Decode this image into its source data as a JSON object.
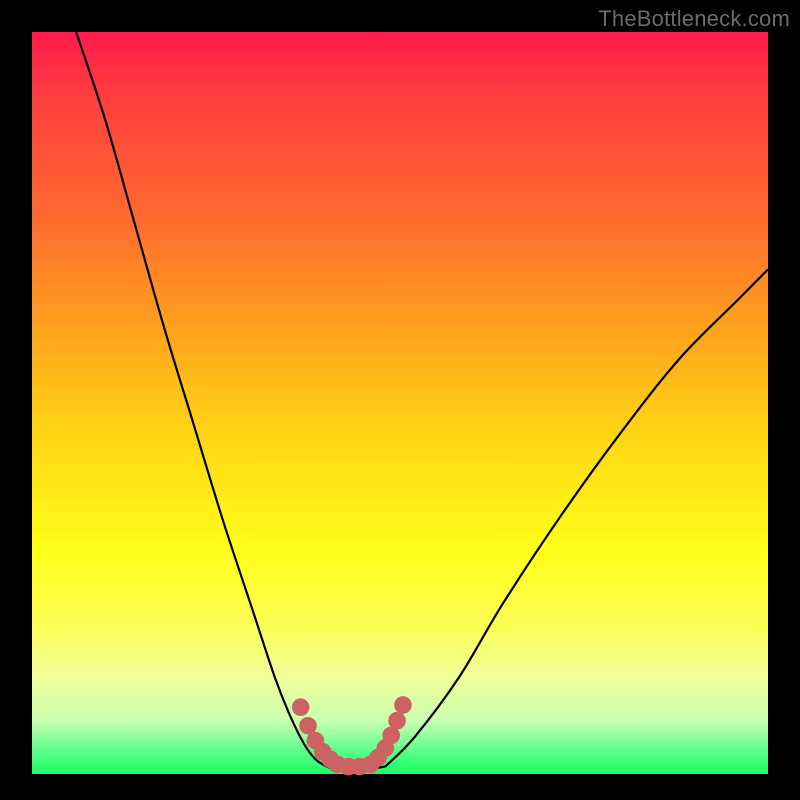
{
  "watermark": "TheBottleneck.com",
  "colors": {
    "gradient_top": "#ff1a4a",
    "gradient_mid": "#ffff1a",
    "gradient_bottom": "#1aff61",
    "curve": "#000000",
    "marker": "#cc6262",
    "frame": "#000000"
  },
  "chart_data": {
    "type": "line",
    "title": "",
    "xlabel": "",
    "ylabel": "",
    "xlim": [
      0,
      100
    ],
    "ylim": [
      0,
      100
    ],
    "grid": false,
    "legend": false,
    "description": "Two monotone curves descending from top toward a flat minimum near the bottom center, then rising; left curve steeper, right curve shallower. Pink markers cluster at/near the valley bottom on both branches.",
    "series": [
      {
        "name": "left-branch",
        "x": [
          6,
          10,
          14,
          18,
          22,
          26,
          30,
          33,
          35,
          37,
          38.5,
          40
        ],
        "y": [
          100,
          88,
          74,
          60,
          47,
          34,
          22,
          13,
          8,
          4,
          2,
          1
        ]
      },
      {
        "name": "valley-floor",
        "x": [
          40,
          42,
          44,
          46,
          48
        ],
        "y": [
          1,
          0.5,
          0.5,
          0.7,
          1
        ]
      },
      {
        "name": "right-branch",
        "x": [
          48,
          52,
          58,
          64,
          72,
          80,
          88,
          96,
          100
        ],
        "y": [
          1,
          5,
          13,
          23,
          35,
          46,
          56,
          64,
          68
        ]
      }
    ],
    "markers": {
      "name": "valley-markers",
      "points": [
        {
          "x": 36.5,
          "y": 9
        },
        {
          "x": 37.5,
          "y": 6.5
        },
        {
          "x": 38.5,
          "y": 4.5
        },
        {
          "x": 39.5,
          "y": 3
        },
        {
          "x": 40.5,
          "y": 2
        },
        {
          "x": 41.5,
          "y": 1.3
        },
        {
          "x": 43.0,
          "y": 1.0
        },
        {
          "x": 44.5,
          "y": 1.0
        },
        {
          "x": 46.0,
          "y": 1.3
        },
        {
          "x": 47.0,
          "y": 2.2
        },
        {
          "x": 48.0,
          "y": 3.5
        },
        {
          "x": 48.8,
          "y": 5.2
        },
        {
          "x": 49.6,
          "y": 7.2
        },
        {
          "x": 50.4,
          "y": 9.3
        }
      ],
      "radius_pct": 1.2
    }
  }
}
